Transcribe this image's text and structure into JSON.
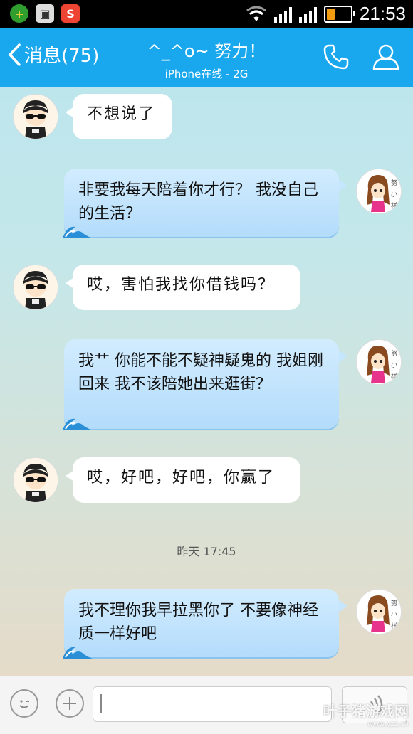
{
  "status_bar": {
    "time": "21:53",
    "battery_level": 0.3
  },
  "header": {
    "back_label": "消息(75)",
    "title": "^_^o~ 努力！",
    "subtitle": "iPhone在线 - 2G"
  },
  "messages": [
    {
      "direction": "in",
      "text": "不想说了"
    },
    {
      "direction": "out",
      "text": "非要我每天陪着你才行？ 我没自己的生活？"
    },
    {
      "direction": "in",
      "text": "哎，害怕我找你借钱吗？"
    },
    {
      "direction": "out",
      "text": "我艹 你能不能不疑神疑鬼的 我姐刚回来 我不该陪她出来逛街？"
    },
    {
      "direction": "in",
      "text": "哎，好吧，好吧，你赢了"
    },
    {
      "direction": "out",
      "text": "我不理你我早拉黑你了 不要像神经质一样好吧"
    }
  ],
  "timestamp": "昨天 17:45",
  "watermark": {
    "main": "叶子猪游戏网",
    "sub": "www.yzz.cn"
  },
  "colors": {
    "header": "#19a7ee",
    "out_bubble": "#c5e6fd",
    "in_bubble": "#ffffff"
  }
}
